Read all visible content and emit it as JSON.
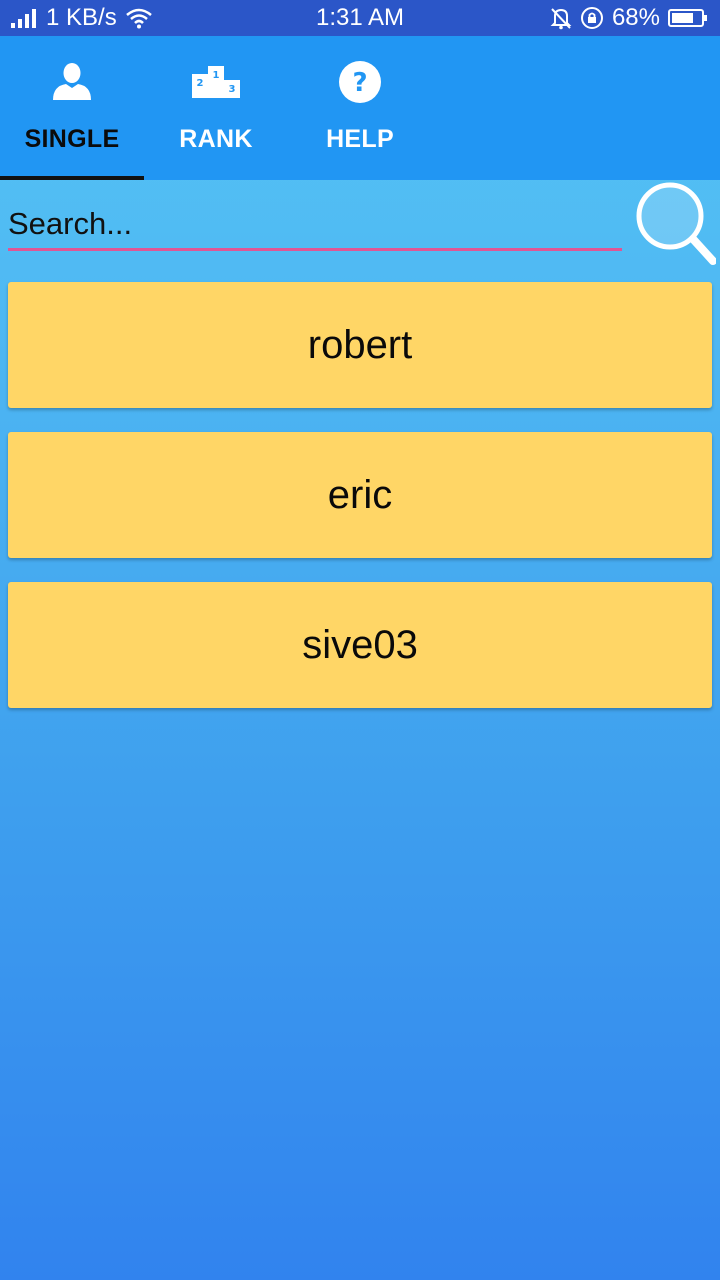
{
  "status_bar": {
    "network_speed": "1 KB/s",
    "time": "1:31 AM",
    "battery": "68%",
    "icons": [
      "signal-icon",
      "wifi-icon",
      "mute-bell-icon",
      "rotation-lock-icon",
      "battery-icon"
    ]
  },
  "tabs": [
    {
      "label": "SINGLE",
      "icon": "person-icon",
      "active": true
    },
    {
      "label": "RANK",
      "icon": "podium-icon",
      "active": false
    },
    {
      "label": "HELP",
      "icon": "help-icon",
      "active": false
    }
  ],
  "search": {
    "placeholder": "Search...",
    "value": "",
    "icon": "search-icon"
  },
  "players": [
    {
      "name": "robert"
    },
    {
      "name": "eric"
    },
    {
      "name": "sive03"
    }
  ],
  "colors": {
    "status_bar": "#2B56C8",
    "header": "#2196F3",
    "card": "#FFD666",
    "search_underline": "#E05595",
    "background_top": "#55C4F4",
    "background_bottom": "#3183EE"
  }
}
